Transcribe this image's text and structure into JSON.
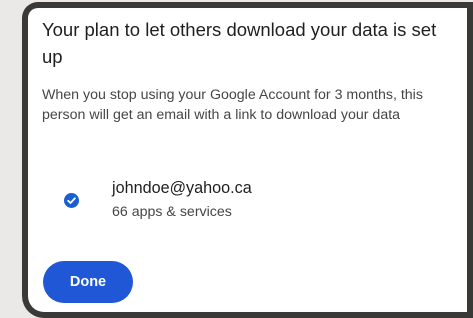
{
  "dialog": {
    "title": "Your plan to let others download your data is set up",
    "description": "When you stop using your Google Account for 3 months, this person will get an email with a link to download your data"
  },
  "recipient": {
    "email": "johndoe@yahoo.ca",
    "services": "66 apps & services",
    "selected": true,
    "icon": "check-circle-icon"
  },
  "actions": {
    "done_label": "Done"
  },
  "colors": {
    "accent": "#1f57d6",
    "check": "#1a5fd1",
    "frame": "#3a3937",
    "background": "#ebe9e7"
  }
}
